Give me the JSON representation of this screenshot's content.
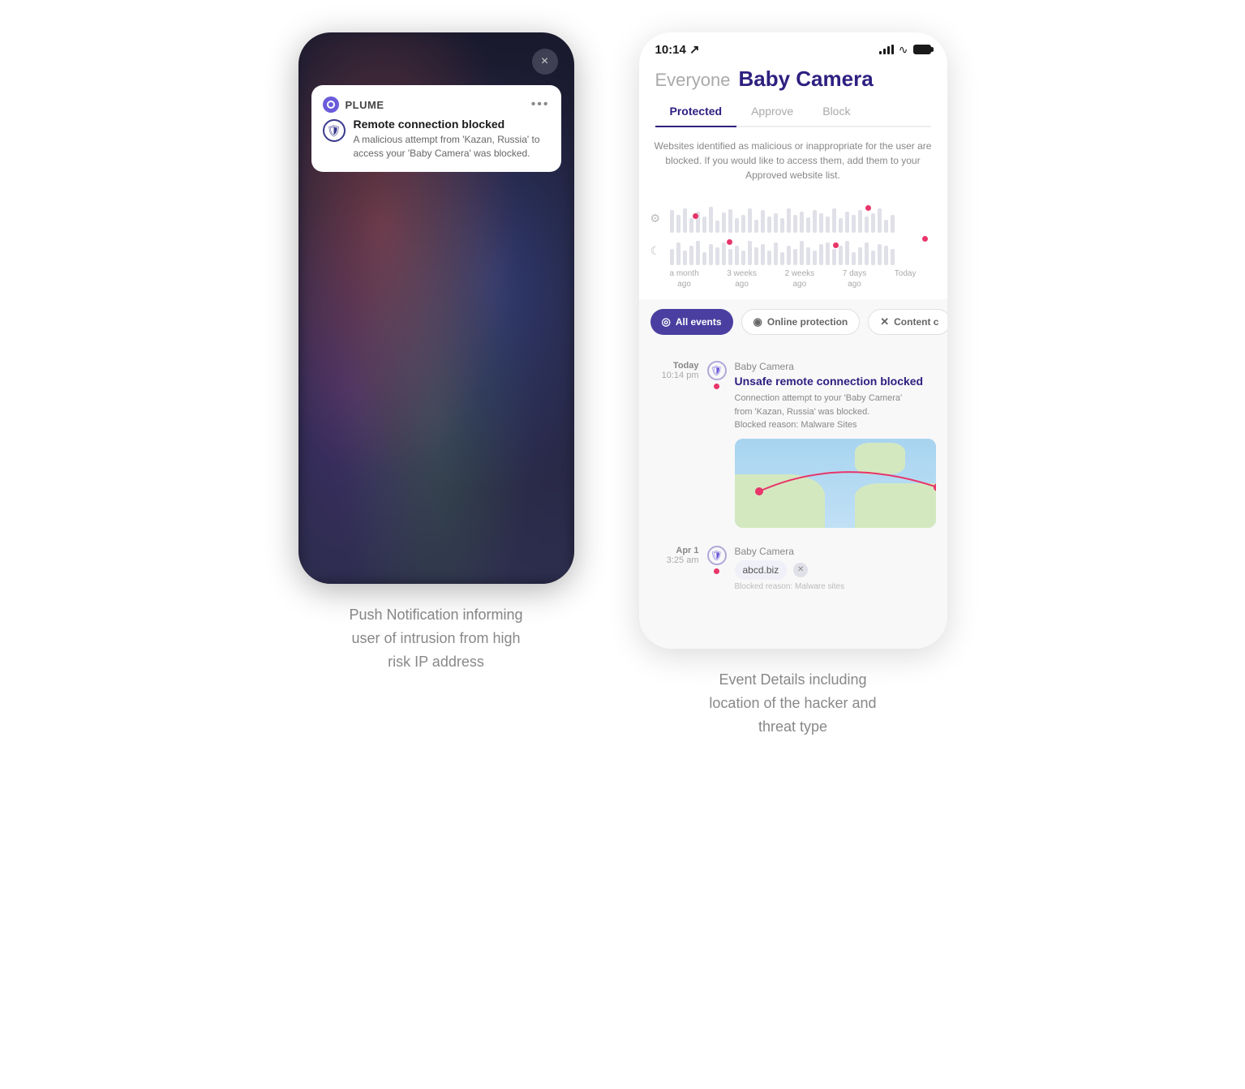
{
  "left_phone": {
    "close_button": "×",
    "notification": {
      "app_name": "PLUME",
      "dots": "•••",
      "title": "Remote connection blocked",
      "description": "A malicious attempt from 'Kazan, Russia' to access your 'Baby Camera' was blocked."
    }
  },
  "right_phone": {
    "status_bar": {
      "time": "10:14",
      "time_arrow": "↗"
    },
    "header": {
      "everyone_label": "Everyone",
      "device_name": "Baby Camera"
    },
    "tabs": [
      {
        "label": "Protected",
        "active": true
      },
      {
        "label": "Approve",
        "active": false
      },
      {
        "label": "Block",
        "active": false
      }
    ],
    "protected_description": "Websites identified as malicious or inappropriate for the user are blocked. If you would like to access them, add them to your Approved website list.",
    "chart_labels": [
      {
        "line1": "a month",
        "line2": "ago"
      },
      {
        "line1": "3 weeks",
        "line2": "ago"
      },
      {
        "line1": "2 weeks",
        "line2": "ago"
      },
      {
        "line1": "7 days",
        "line2": "ago"
      },
      {
        "line1": "Today",
        "line2": ""
      }
    ],
    "filter_pills": [
      {
        "label": "All events",
        "active": true,
        "icon": "◎"
      },
      {
        "label": "Online protection",
        "active": false,
        "icon": "◉"
      },
      {
        "label": "Content c",
        "active": false,
        "icon": "✕"
      }
    ],
    "events": [
      {
        "date": "Today",
        "time": "10:14 pm",
        "device": "Baby Camera",
        "title": "Unsafe remote connection blocked",
        "description": "Connection attempt to your 'Baby Camera'\nfrom 'Kazan, Russia' was blocked.\nBlocked reason: Malware Sites",
        "has_map": true
      },
      {
        "date": "Apr 1",
        "time": "3:25 am",
        "device": "Baby Camera",
        "blocked_url": "abcd.biz",
        "blocked_desc": "Blocked reason: Malware sites"
      }
    ]
  },
  "captions": {
    "left": "Push Notification informing\nuser of intrusion from high\nrisk IP address",
    "right": "Event Details including\nlocation of the hacker and\nthreat type"
  }
}
